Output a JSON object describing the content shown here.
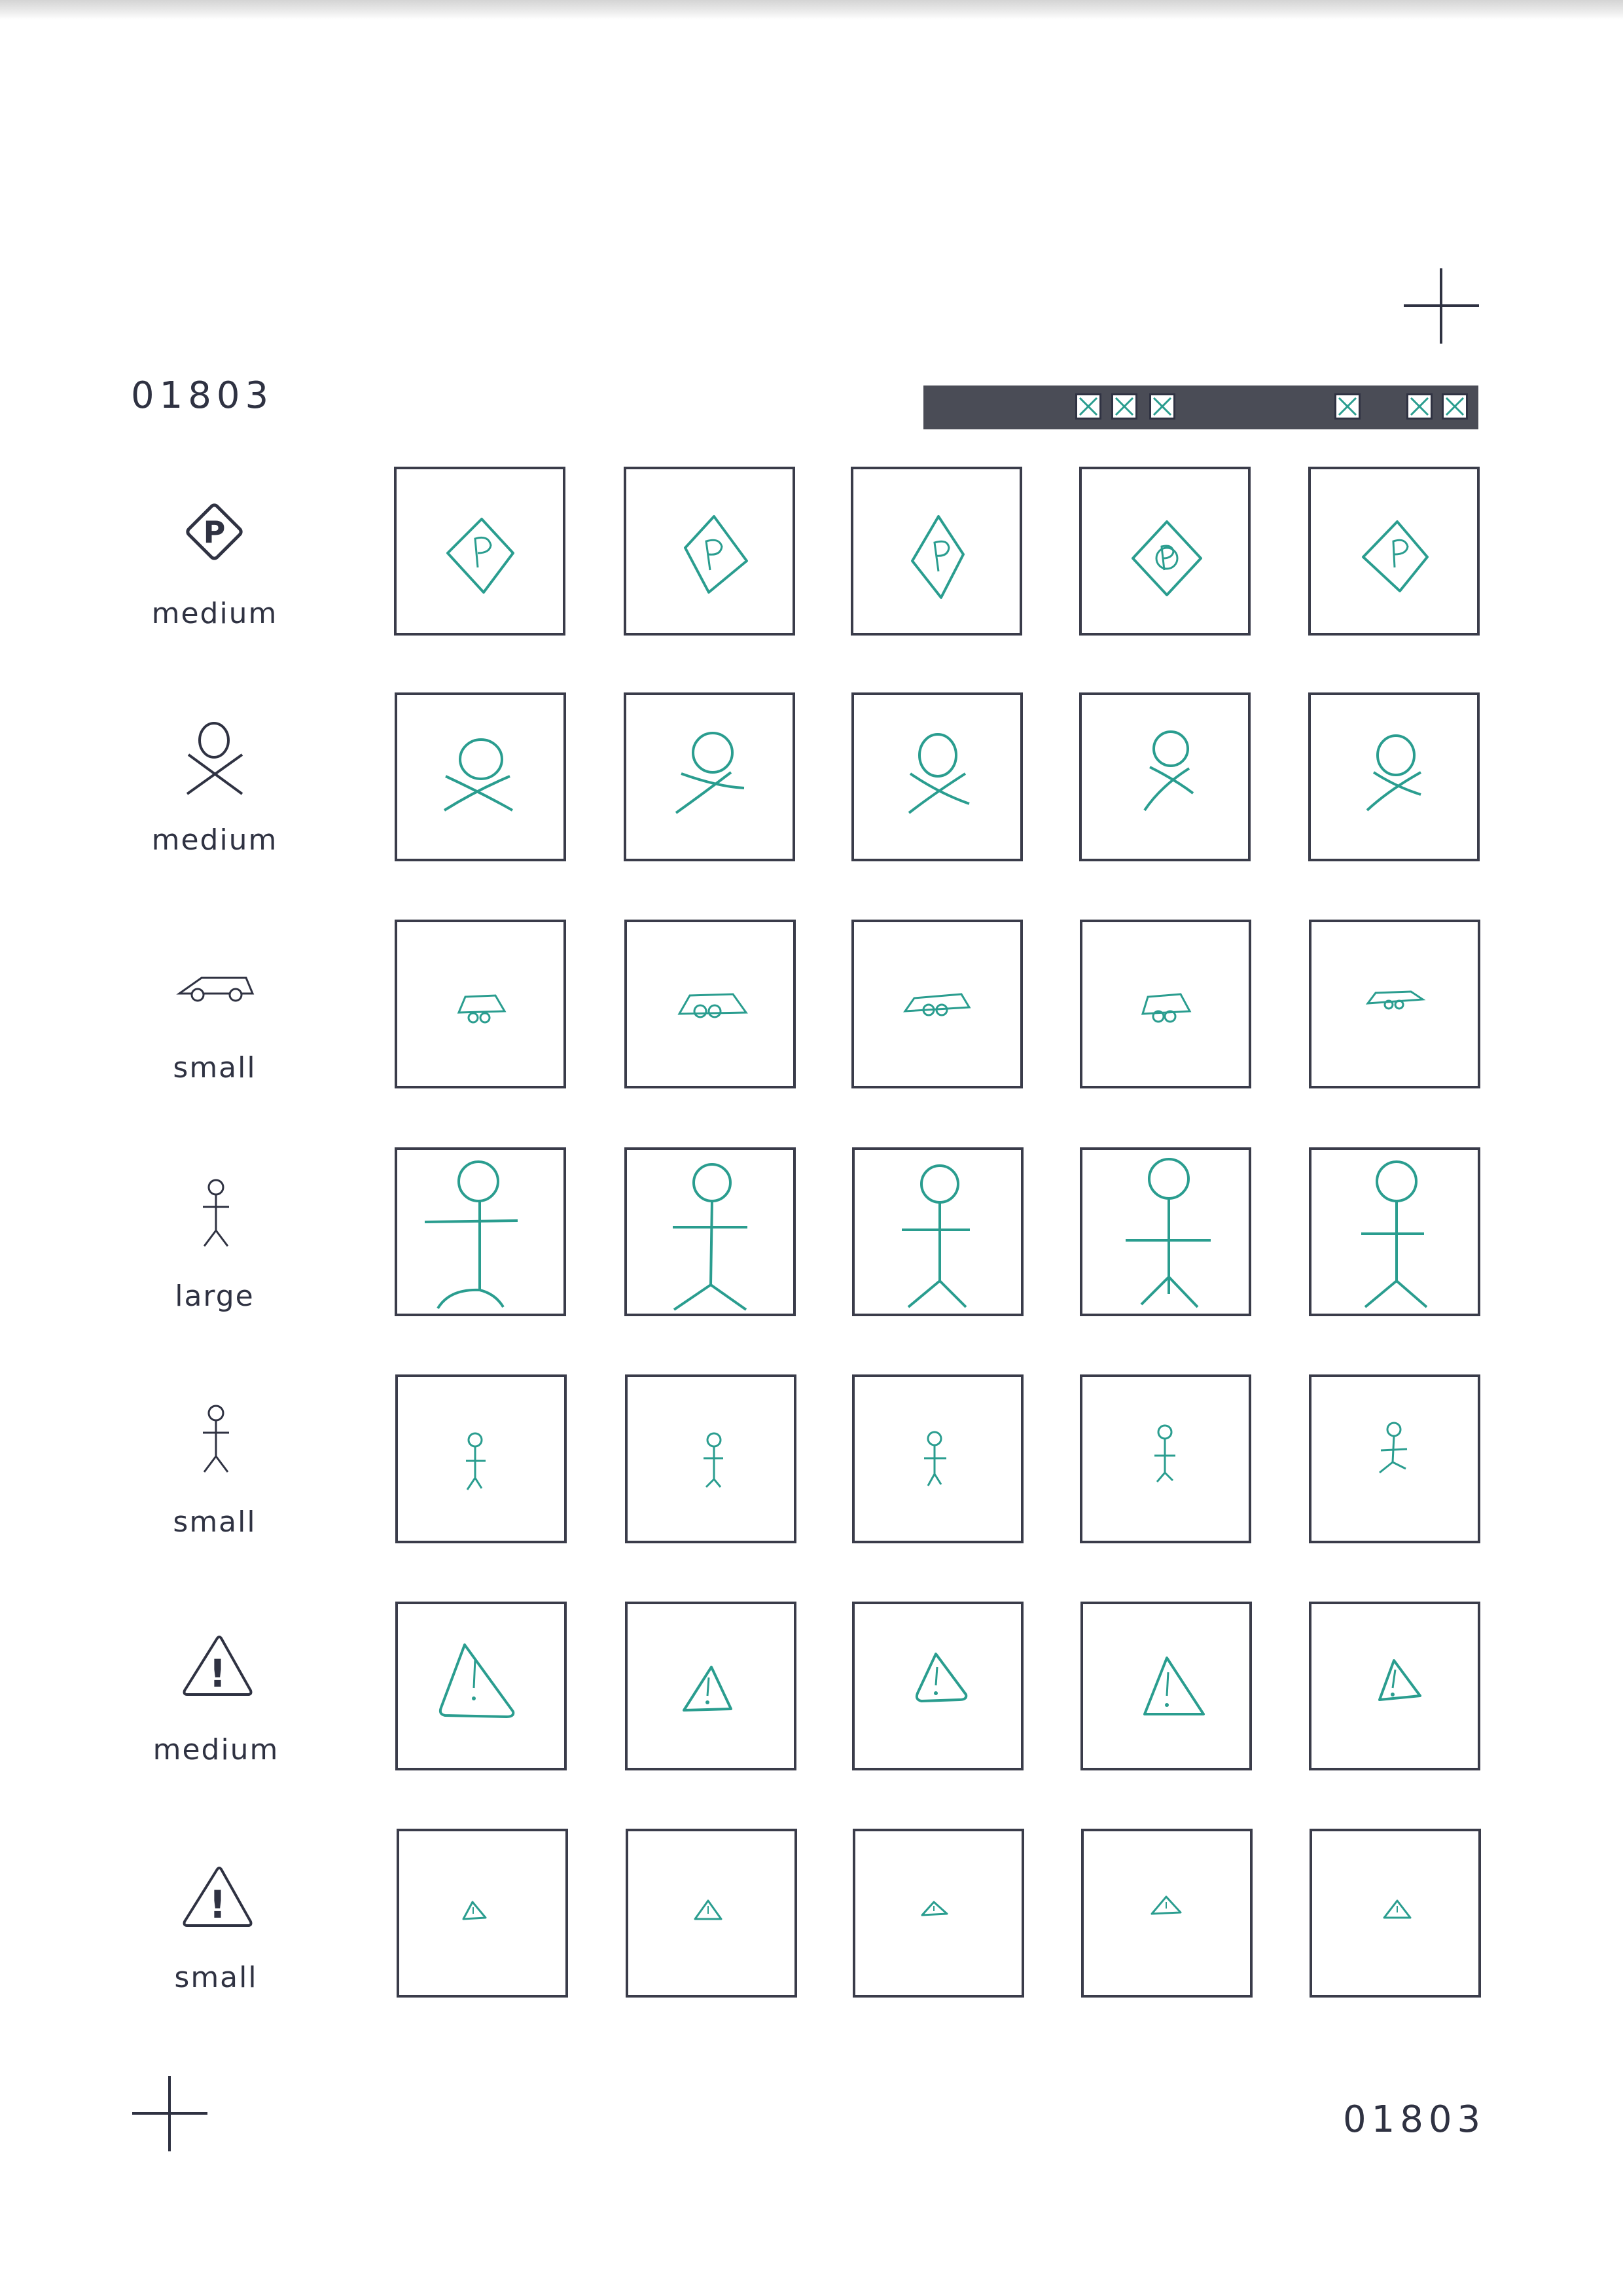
{
  "form_number": "01803",
  "footer_number": "01803",
  "colors": {
    "ink": "#2f3242",
    "pen": "#2a9d8f",
    "bar": "#4a4c56"
  },
  "rows": [
    {
      "icon": "parking-icon",
      "icon_letter": "P",
      "size": "medium"
    },
    {
      "icon": "skull-crossbones-icon",
      "size": "medium"
    },
    {
      "icon": "car-icon",
      "size": "small"
    },
    {
      "icon": "stick-figure-icon",
      "size": "large"
    },
    {
      "icon": "stick-figure-icon",
      "size": "small"
    },
    {
      "icon": "warning-triangle-icon",
      "icon_letter": "!",
      "size": "medium"
    },
    {
      "icon": "warning-triangle-icon",
      "icon_letter": "!",
      "size": "small"
    }
  ],
  "columns_per_row": 5
}
